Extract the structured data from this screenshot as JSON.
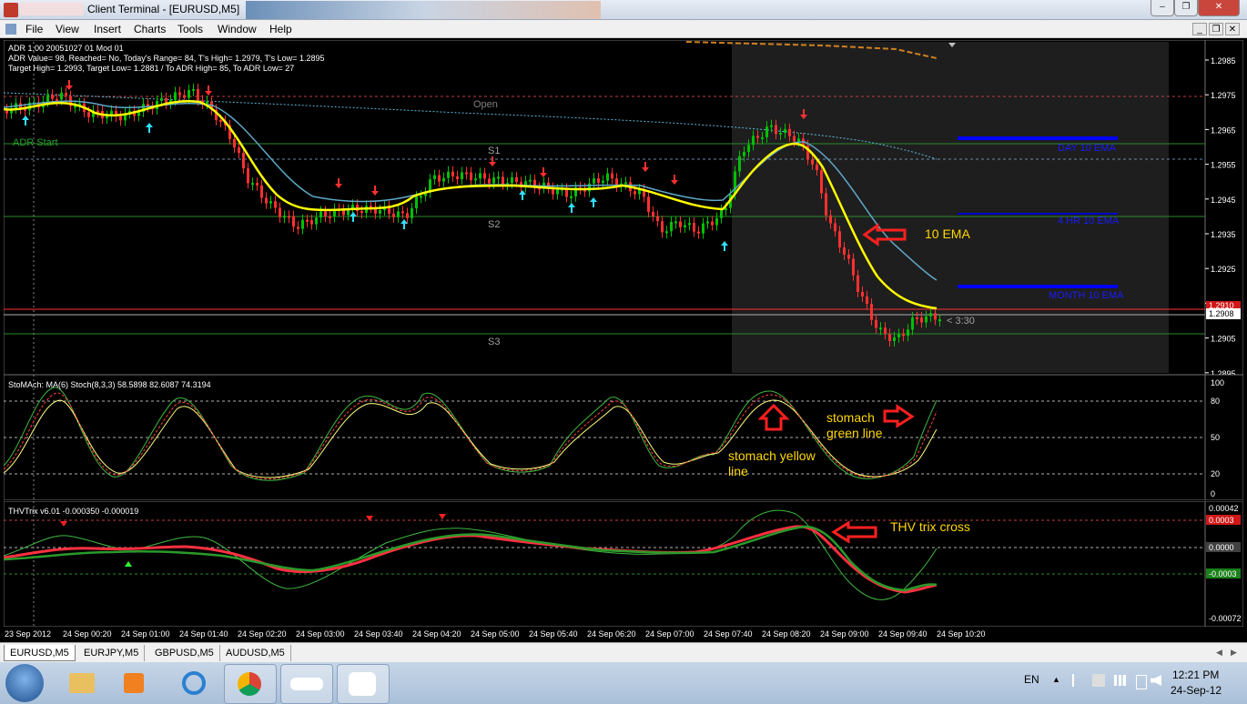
{
  "window": {
    "title": "Client Terminal - [EURUSD,M5]"
  },
  "menu": [
    "File",
    "View",
    "Insert",
    "Charts",
    "Tools",
    "Window",
    "Help"
  ],
  "main_chart": {
    "info_lines": [
      "ADR 1.00 20051027 01 Mod 01",
      "ADR Value= 98, Reached= No, Today's Range= 84, T's High= 1.2979, T's Low= 1.2895",
      "Target High= 1.2993, Target Low= 1.2881 / To ADR High= 85, To ADR Low= 27"
    ],
    "adr_start": "ADR Start",
    "open_label": "Open",
    "s1": "S1",
    "s2": "S2",
    "s3": "S3",
    "ema_labels": [
      "DAY 10 EMA",
      "4 HR 10 EMA",
      "MONTH 10 EMA"
    ],
    "annotation_ema": "10 EMA",
    "countdown": "< 3:30",
    "price_labels": [
      "1.2985",
      "1.2975",
      "1.2965",
      "1.2955",
      "1.2945",
      "1.2935",
      "1.2925",
      "1.2915",
      "1.2905",
      "1.2895"
    ],
    "current_price": "1.2908",
    "red_price": "1.2910"
  },
  "stoch_panel": {
    "header": "StoMAch: MA(6)  Stoch(8,3,3) 58.5898 82.6087 74.3194",
    "levels": [
      "100",
      "80",
      "50",
      "20",
      "0"
    ],
    "annotation_green": [
      "stomach",
      "green line"
    ],
    "annotation_yellow": [
      "stomach yellow",
      "line"
    ]
  },
  "trix_panel": {
    "header": "THVTrix v6.01 -0.000350 -0.000019",
    "levels": [
      "0.00042",
      "0.0003",
      "0.0000",
      "-0.0003",
      "-0.00072"
    ],
    "annotation": "THV trix cross"
  },
  "time_axis": [
    "23 Sep 2012",
    "24 Sep 00:20",
    "24 Sep 01:00",
    "24 Sep 01:40",
    "24 Sep 02:20",
    "24 Sep 03:00",
    "24 Sep 03:40",
    "24 Sep 04:20",
    "24 Sep 05:00",
    "24 Sep 05:40",
    "24 Sep 06:20",
    "24 Sep 07:00",
    "24 Sep 07:40",
    "24 Sep 08:20",
    "24 Sep 09:00",
    "24 Sep 09:40",
    "24 Sep 10:20"
  ],
  "tabs": [
    "EURUSD,M5",
    "EURJPY,M5",
    "GBPUSD,M5",
    "AUDUSD,M5"
  ],
  "tray": {
    "lang": "EN",
    "time": "12:21 PM",
    "date": "24-Sep-12"
  },
  "colors": {
    "bull": "#00c000",
    "bear": "#ff3030",
    "ema_yellow": "#ffff00",
    "ema_blue": "#0000ff",
    "annotation": "#ffd700",
    "arrow_red": "#ff0000"
  }
}
